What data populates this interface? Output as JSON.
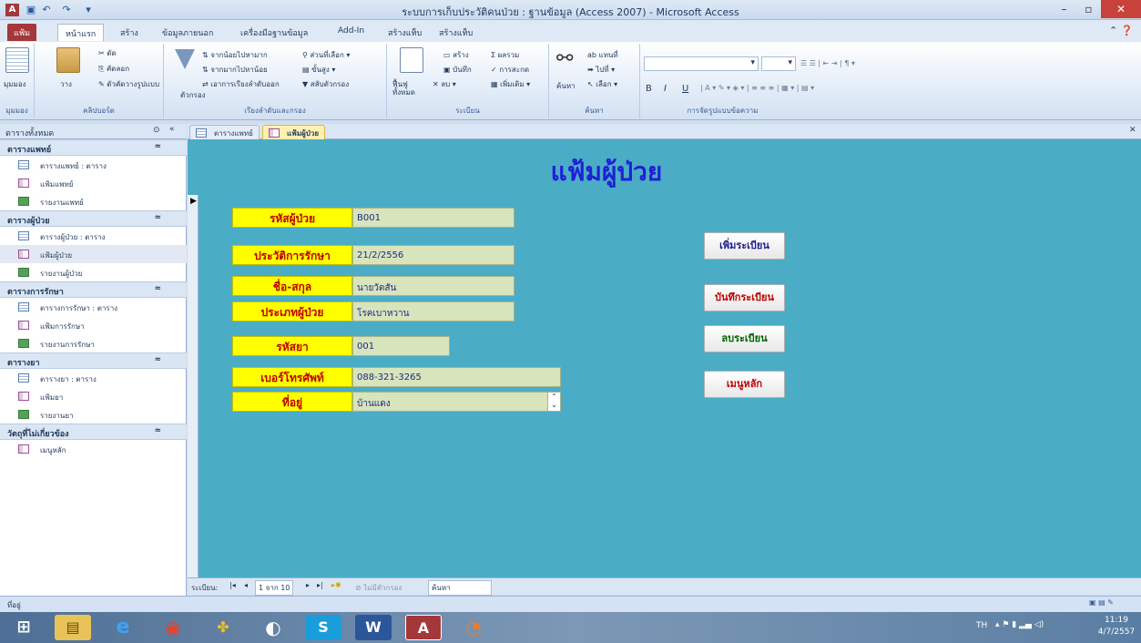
{
  "window": {
    "title": "ระบบการเก็บประวัติคนป่วย : ฐานข้อมูล (Access 2007) - Microsoft Access",
    "app_icon": "A",
    "minimize": "–",
    "maximize": "▫",
    "close": "✕"
  },
  "ribbon_tabs": [
    {
      "label": "แฟ้ม"
    },
    {
      "label": "หน้าแรก"
    },
    {
      "label": "สร้าง"
    },
    {
      "label": "ข้อมูลภายนอก"
    },
    {
      "label": "เครื่องมือฐานข้อมูล"
    },
    {
      "label": "Add-In"
    },
    {
      "label": "สร้างแท็บ"
    },
    {
      "label": "สร้างแท็บ"
    }
  ],
  "ribbon": {
    "views": {
      "view": "มุมมอง",
      "group": "มุมมอง"
    },
    "clipboard": {
      "cut": "ตัด",
      "copy": "คัดลอก",
      "paste": "วาง",
      "format_painter": "ตัวคัดวางรูปแบบ",
      "group": "คลิปบอร์ด"
    },
    "sort_filter": {
      "filter": "ตัวกรอง",
      "asc": "จากน้อยไปหามาก",
      "desc": "จากมากไปหาน้อย",
      "remove_sort": "เอาการเรียงลำดับออก",
      "selection": "ส่วนที่เลือก",
      "advanced": "ขั้นสูง",
      "toggle": "สลับตัวกรอง",
      "group": "เรียงลำดับและกรอง"
    },
    "records": {
      "refresh": "ฟื้นฟูทั้งหมด",
      "new": "สร้าง",
      "save": "บันทึก",
      "delete": "ลบ",
      "totals": "ผลรวม",
      "spelling": "การสะกด",
      "more": "เพิ่มเติม",
      "group": "ระเบียน"
    },
    "find": {
      "find": "ค้นหา",
      "replace": "แทนที่",
      "goto": "ไปที่",
      "select": "เลือก",
      "group": "ค้นหา"
    },
    "text_format": {
      "group": "การจัดรูปแบบข้อความ",
      "bold": "B",
      "italic": "I",
      "underline": "U"
    }
  },
  "nav_pane": {
    "title": "ตารางทั้งหมด",
    "groups": [
      {
        "name": "ตารางแพทย์",
        "items": [
          {
            "label": "ตารางแพทย์ : ตาราง",
            "type": "table"
          },
          {
            "label": "แฟ้มแพทย์",
            "type": "form"
          },
          {
            "label": "รายงานแพทย์",
            "type": "report"
          }
        ]
      },
      {
        "name": "ตารางผู้ป่วย",
        "items": [
          {
            "label": "ตารางผู้ป่วย : ตาราง",
            "type": "table"
          },
          {
            "label": "แฟ้มผู้ป่วย",
            "type": "form"
          },
          {
            "label": "รายงานผู้ป่วย",
            "type": "report"
          }
        ]
      },
      {
        "name": "ตารางการรักษา",
        "items": [
          {
            "label": "ตารางการรักษา : ตาราง",
            "type": "table"
          },
          {
            "label": "แฟ้มการรักษา",
            "type": "form"
          },
          {
            "label": "รายงานการรักษา",
            "type": "report"
          }
        ]
      },
      {
        "name": "ตารางยา",
        "items": [
          {
            "label": "ตารางยา : ตาราง",
            "type": "table"
          },
          {
            "label": "แฟ้มยา",
            "type": "form"
          },
          {
            "label": "รายงานยา",
            "type": "report"
          }
        ]
      },
      {
        "name": "วัตถุที่ไม่เกี่ยวข้อง",
        "items": [
          {
            "label": "เมนูหลัก",
            "type": "form"
          }
        ]
      }
    ]
  },
  "doc_tabs": [
    {
      "label": "ตารางแพทย์"
    },
    {
      "label": "แฟ้มผู้ป่วย"
    }
  ],
  "form": {
    "title": "แฟ้มผู้ป่วย",
    "fields": [
      {
        "label": "รหัสผู้ป่วย",
        "value": "B001"
      },
      {
        "label": "ประวัติการรักษา",
        "value": "21/2/2556"
      },
      {
        "label": "ชื่อ-สกุล",
        "value": "นายวัตสัน"
      },
      {
        "label": "ประเภทผู้ป่วย",
        "value": "โรคเบาหวาน"
      },
      {
        "label": "รหัสยา",
        "value": "001"
      },
      {
        "label": "เบอร์โทรศัพท์",
        "value": "088-321-3265"
      },
      {
        "label": "ที่อยู่",
        "value": "บ้านแดง"
      }
    ],
    "buttons": [
      {
        "label": "เพิ่มระเบียน",
        "color": "#1f1f8f"
      },
      {
        "label": "บันทึกระเบียน",
        "color": "#c00000"
      },
      {
        "label": "ลบระเบียน",
        "color": "#006100"
      },
      {
        "label": "เมนูหลัก",
        "color": "#c00000"
      }
    ]
  },
  "record_nav": {
    "label": "ระเบียน:",
    "position": "1 จาก 10",
    "filter": "ไม่มีตัวกรอง",
    "search": "ค้นหา"
  },
  "status": {
    "text": "ที่อยู่"
  },
  "taskbar": {
    "lang": "TH",
    "time": "11:19",
    "date": "4/7/2557"
  }
}
